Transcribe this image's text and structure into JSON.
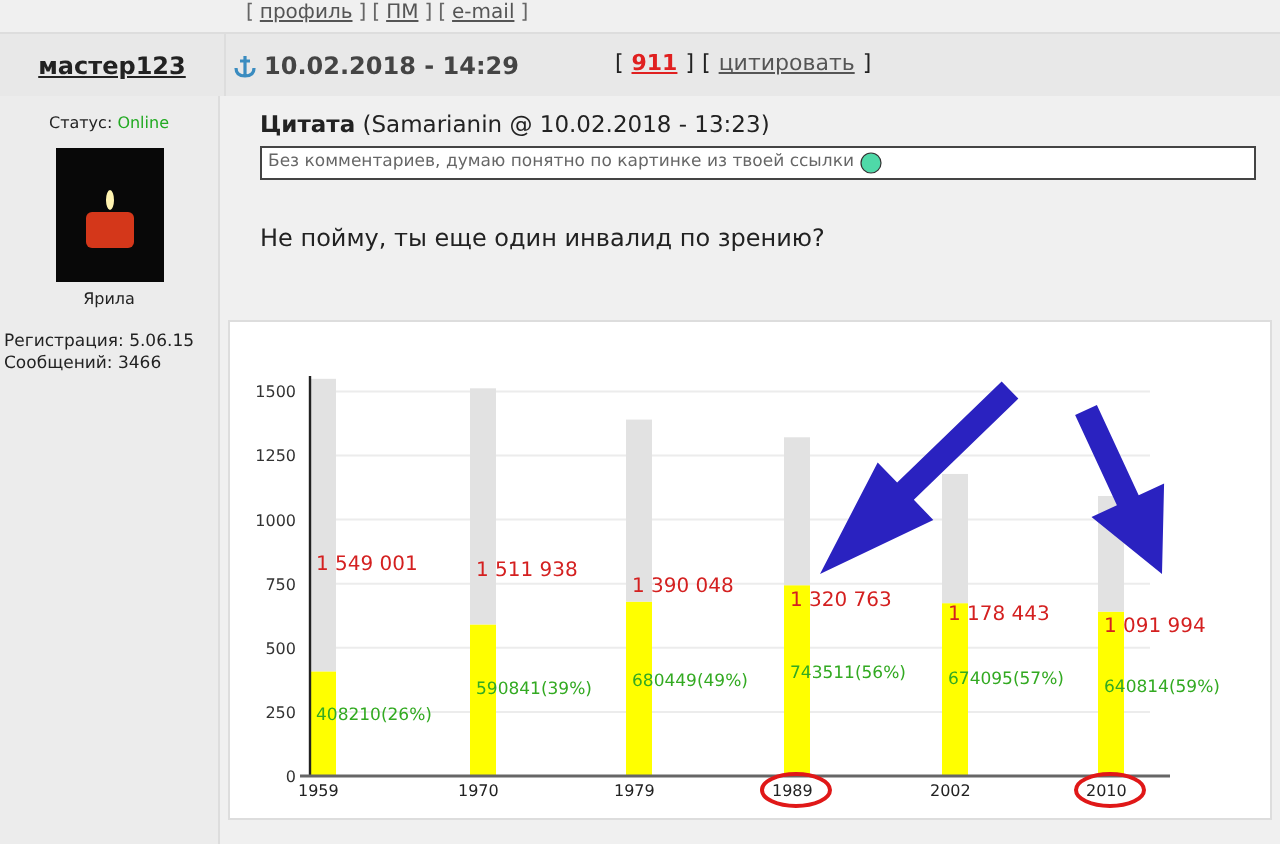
{
  "top_links": {
    "bracket_open": "[",
    "bracket_close": "]",
    "links": [
      "профиль",
      "ПМ",
      "e-mail"
    ]
  },
  "post": {
    "author": "мастер123",
    "date": "10.02.2018 - 14:29",
    "bracket_open": "[",
    "bracket_close": "]",
    "number": "911",
    "quote_link": "цитировать",
    "status_label": "Статус:",
    "status": "Online",
    "avatar_caption": "Ярила",
    "registration": "Регистрация: 5.06.15",
    "messages": "Сообщений: 3466",
    "quote": {
      "title": "Цитата",
      "source": "(Samarianin @ 10.02.2018 - 13:23)",
      "text": "Без комментариев, думаю понятно по картинке из твоей ссылки"
    },
    "text": "Не пойму, ты еще один инвалид по зрению?",
    "chart_data": {
      "type": "bar",
      "categories": [
        "1959",
        "1970",
        "1979",
        "1989",
        "2002",
        "2010"
      ],
      "ylim": [
        0,
        1560
      ],
      "yticks": [
        0,
        250,
        500,
        750,
        1000,
        1250,
        1500
      ],
      "stacked": true,
      "grid": true,
      "series": [
        {
          "color": "#ffff00",
          "values": [
            408,
            591,
            680,
            744,
            674,
            641
          ]
        },
        {
          "color": "#e2e2e2",
          "values": [
            1141,
            921,
            710,
            577,
            504,
            451
          ]
        }
      ],
      "annotations": [
        {
          "text": "1 549 001",
          "x": "1959",
          "y": 897
        },
        {
          "text": "1 511 938",
          "x": "1970",
          "y": 874
        },
        {
          "text": "1 390 048",
          "x": "1979",
          "y": 811
        },
        {
          "text": "1 320 763",
          "x": "1989",
          "y": 757
        },
        {
          "text": "1 178 443",
          "x": "2002",
          "y": 702
        },
        {
          "text": "1 091 994",
          "x": "2010",
          "y": 655
        },
        {
          "text": "408210(26%)",
          "x": "1959",
          "y": 250
        },
        {
          "text": "590841(39%)",
          "x": "1970",
          "y": 351
        },
        {
          "text": "680449(49%)",
          "x": "1979",
          "y": 382
        },
        {
          "text": "743511(56%)",
          "x": "1989",
          "y": 413
        },
        {
          "text": "674095(57%)",
          "x": "2002",
          "y": 390
        },
        {
          "text": "640814(59%)",
          "x": "2010",
          "y": 359
        }
      ]
    }
  }
}
